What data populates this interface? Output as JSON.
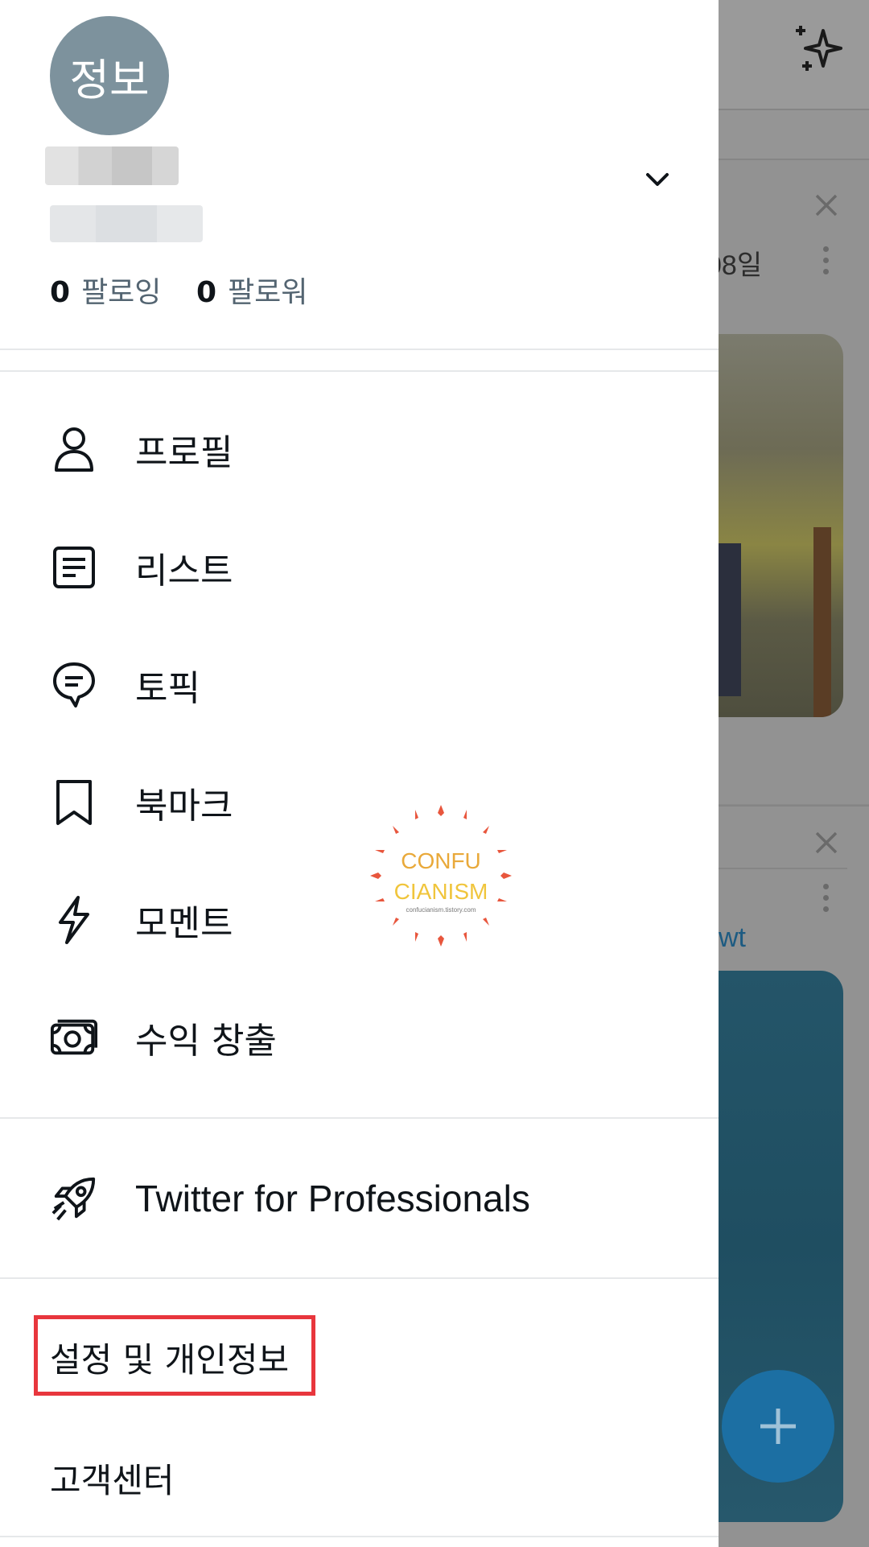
{
  "profile": {
    "avatar_text": "정보",
    "following_count": "0",
    "following_label": "팔로잉",
    "followers_count": "0",
    "followers_label": "팔로워"
  },
  "menu": {
    "items": [
      {
        "label": "프로필",
        "icon": "person-icon"
      },
      {
        "label": "리스트",
        "icon": "list-icon"
      },
      {
        "label": "토픽",
        "icon": "topic-icon"
      },
      {
        "label": "북마크",
        "icon": "bookmark-icon"
      },
      {
        "label": "모멘트",
        "icon": "lightning-icon"
      },
      {
        "label": "수익 창출",
        "icon": "money-icon"
      }
    ],
    "professional": {
      "label": "Twitter for Professionals",
      "icon": "rocket-icon"
    },
    "settings_label": "설정 및 개인정보",
    "help_label": "고객센터"
  },
  "background": {
    "date_fragment": "08일",
    "link_fragment": "wt",
    "fab_icon": "plus-icon",
    "top_icon": "sparkle-icon"
  },
  "watermark": {
    "line1": "CONFU",
    "line2": "CIANISM",
    "line3": "confucianism.tistory.com"
  },
  "colors": {
    "avatar_bg": "#7d929d",
    "highlight_border": "#e8363d",
    "fab": "#1c6fa3"
  }
}
